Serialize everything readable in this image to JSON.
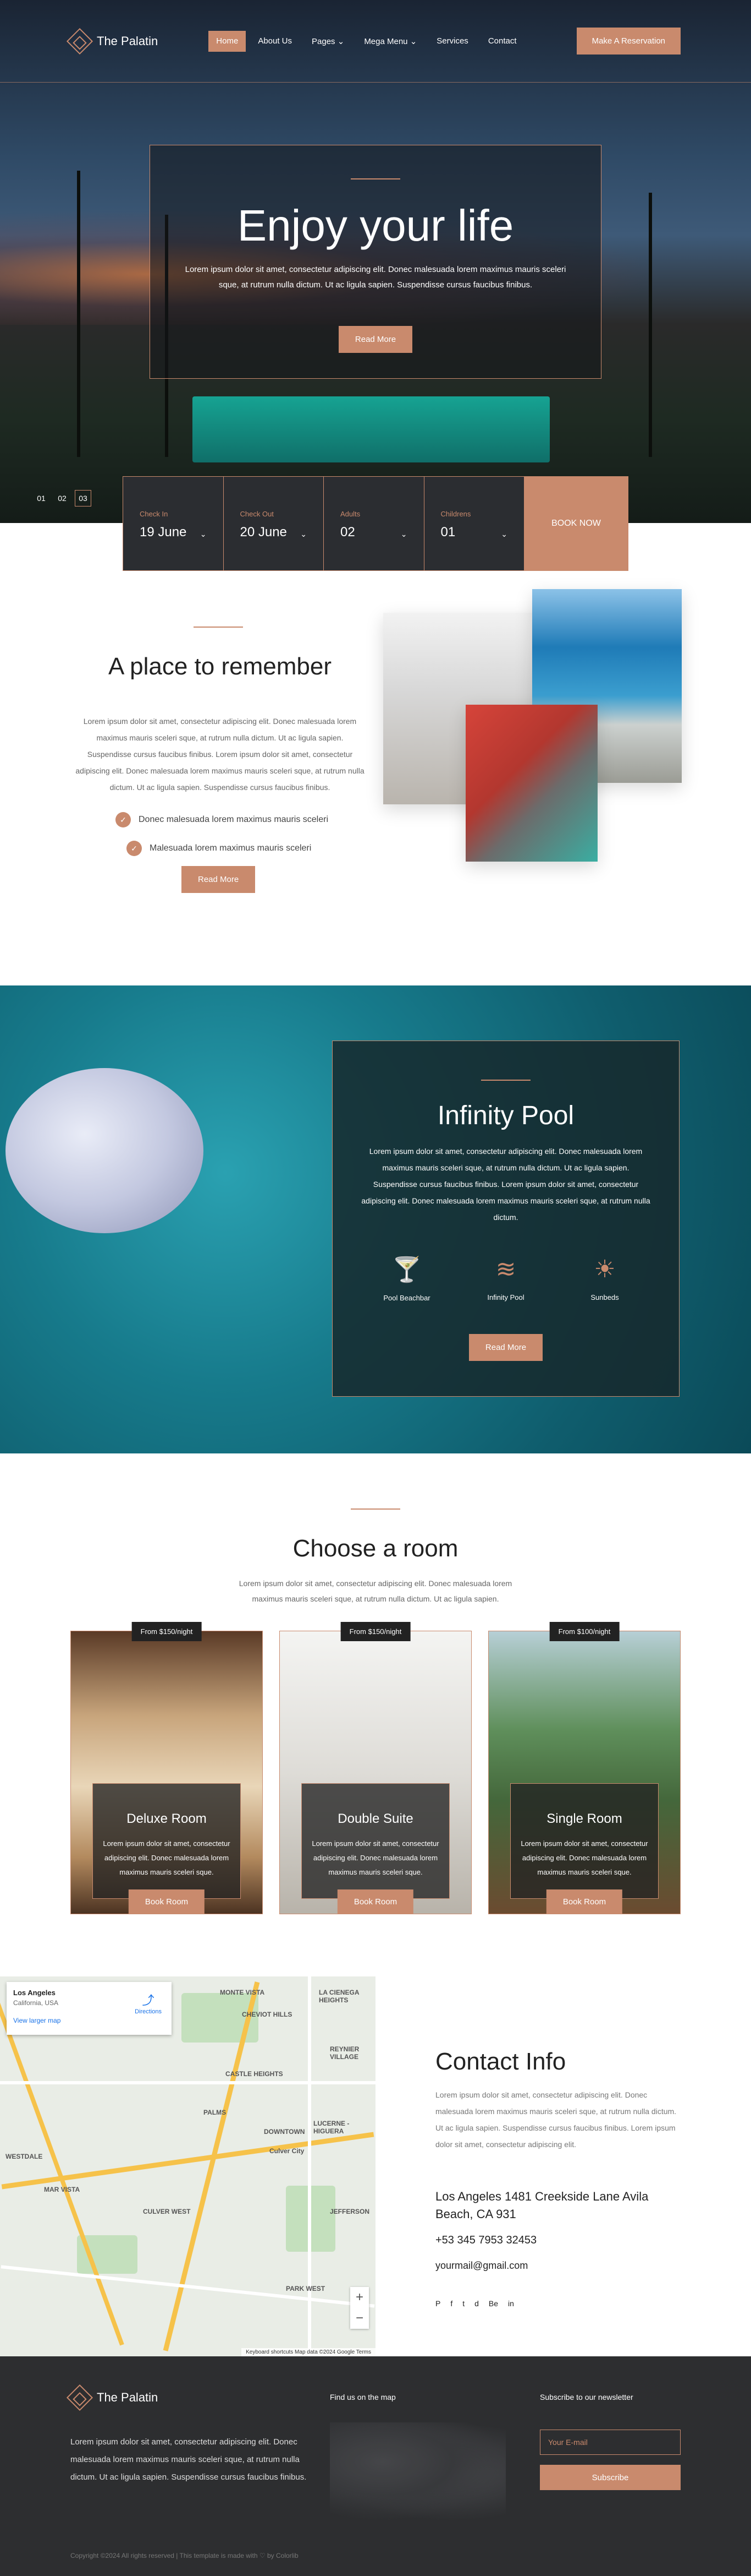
{
  "brand": {
    "name": "The Palatin"
  },
  "nav": {
    "items": [
      {
        "label": "Home"
      },
      {
        "label": "About Us"
      },
      {
        "label": "Pages"
      },
      {
        "label": "Mega Menu"
      },
      {
        "label": "Services"
      },
      {
        "label": "Contact"
      }
    ],
    "cta": "Make A Reservation"
  },
  "hero": {
    "title": "Enjoy your life",
    "text": "Lorem ipsum dolor sit amet, consectetur adipiscing elit. Donec malesuada lorem maximus mauris sceleri sque, at rutrum nulla dictum. Ut ac ligula sapien. Suspendisse cursus faucibus finibus.",
    "button": "Read More",
    "slides": [
      "01",
      "02",
      "03"
    ]
  },
  "booking": {
    "fields": [
      {
        "label": "Check In",
        "value": "19 June"
      },
      {
        "label": "Check Out",
        "value": "20 June"
      },
      {
        "label": "Adults",
        "value": "02"
      },
      {
        "label": "Childrens",
        "value": "01"
      }
    ],
    "button": "BOOK NOW"
  },
  "about": {
    "title": "A place to remember",
    "text": "Lorem ipsum dolor sit amet, consectetur adipiscing elit. Donec malesuada lorem maximus mauris sceleri sque, at rutrum nulla dictum. Ut ac ligula sapien. Suspendisse cursus faucibus finibus. Lorem ipsum dolor sit amet, consectetur adipiscing elit. Donec malesuada lorem maximus mauris sceleri sque, at rutrum nulla dictum. Ut ac ligula sapien. Suspendisse cursus faucibus finibus.",
    "list": [
      "Donec malesuada lorem maximus mauris sceleri",
      "Malesuada lorem maximus mauris sceleri"
    ],
    "button": "Read More"
  },
  "pool": {
    "title": "Infinity Pool",
    "text": "Lorem ipsum dolor sit amet, consectetur adipiscing elit. Donec malesuada lorem maximus mauris sceleri sque, at rutrum nulla dictum. Ut ac ligula sapien. Suspendisse cursus faucibus finibus. Lorem ipsum dolor sit amet, consectetur adipiscing elit. Donec malesuada lorem maximus mauris sceleri sque, at rutrum nulla dictum.",
    "amenities": [
      {
        "label": "Pool Beachbar",
        "icon": "cocktail-icon"
      },
      {
        "label": "Infinity Pool",
        "icon": "pool-icon"
      },
      {
        "label": "Sunbeds",
        "icon": "sunbed-icon"
      }
    ],
    "button": "Read More"
  },
  "rooms": {
    "title": "Choose a room",
    "sub": "Lorem ipsum dolor sit amet, consectetur adipiscing elit. Donec malesuada lorem maximus mauris sceleri sque, at rutrum nulla dictum. Ut ac ligula sapien.",
    "items": [
      {
        "price": "From $150/night",
        "name": "Deluxe Room",
        "text": "Lorem ipsum dolor sit amet, consectetur adipiscing elit. Donec malesuada lorem maximus mauris sceleri sque.",
        "button": "Book Room"
      },
      {
        "price": "From $150/night",
        "name": "Double Suite",
        "text": "Lorem ipsum dolor sit amet, consectetur adipiscing elit. Donec malesuada lorem maximus mauris sceleri sque.",
        "button": "Book Room"
      },
      {
        "price": "From $100/night",
        "name": "Single Room",
        "text": "Lorem ipsum dolor sit amet, consectetur adipiscing elit. Donec malesuada lorem maximus mauris sceleri sque.",
        "button": "Book Room"
      }
    ]
  },
  "map": {
    "place": "Los Angeles",
    "region": "California, USA",
    "link": "View larger map",
    "directions": "Directions",
    "attribution": "Keyboard shortcuts   Map data ©2024 Google   Terms",
    "labels": [
      "MONTE VISTA",
      "LA CIENEGA HEIGHTS",
      "CHEVIOT HILLS",
      "CASTLE HEIGHTS",
      "REYNIER VILLAGE",
      "PALMS",
      "DOWNTOWN",
      "Culver City",
      "WESTDALE",
      "MAR VISTA",
      "LUCERNE - HIGUERA",
      "JEFFERSON",
      "PARK WEST",
      "CULVER WEST"
    ]
  },
  "contact": {
    "title": "Contact Info",
    "text": "Lorem ipsum dolor sit amet, consectetur adipiscing elit. Donec malesuada lorem maximus mauris sceleri sque, at rutrum nulla dictum. Ut ac ligula sapien. Suspendisse cursus faucibus finibus. Lorem ipsum dolor sit amet, consectetur adipiscing elit.",
    "address": "Los Angeles 1481 Creekside Lane Avila Beach, CA 931",
    "phone": "+53 345 7953 32453",
    "email": "yourmail@gmail.com",
    "social": [
      "P",
      "f",
      "t",
      "d",
      "Be",
      "in"
    ]
  },
  "footer": {
    "text": "Lorem ipsum dolor sit amet, consectetur adipiscing elit. Donec malesuada lorem maximus mauris sceleri sque, at rutrum nulla dictum. Ut ac ligula sapien. Suspendisse cursus faucibus finibus.",
    "map_heading": "Find us on the map",
    "newsletter_heading": "Subscribe to our newsletter",
    "newsletter_placeholder": "Your E-mail",
    "subscribe": "Subscribe",
    "copyright": "Copyright ©2024 All rights reserved | This template is made with ♡ by Colorlib"
  },
  "colors": {
    "accent": "#c98a6d",
    "dark": "#2d2e30"
  }
}
